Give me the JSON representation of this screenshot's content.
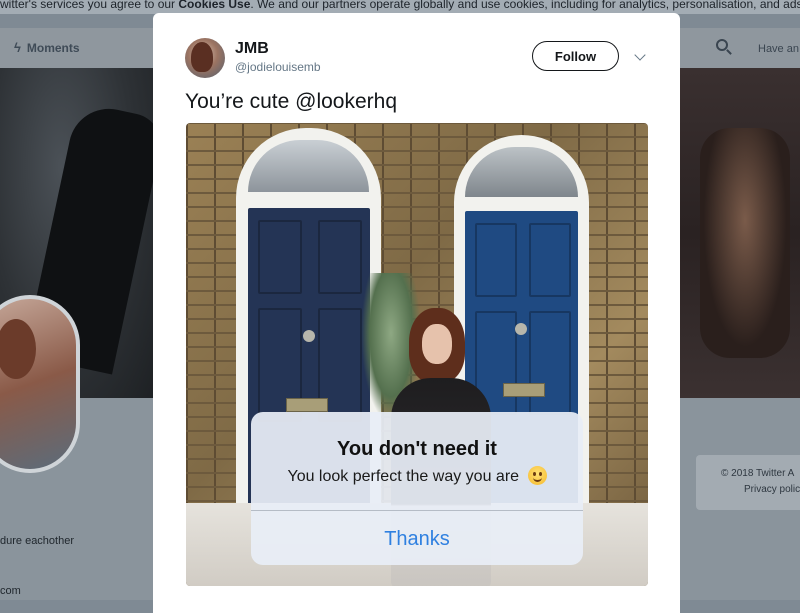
{
  "background_page": {
    "cookie_bar": {
      "prefix": "witter's services you agree to our ",
      "link": "Cookies Use",
      "suffix": ". We and our partners operate globally and use cookies, including for analytics, personalisation, and ads."
    },
    "nav": {
      "moments_label": "Moments",
      "have_account_label": "Have an"
    },
    "profile": {
      "bio_line": "dure eachother",
      "bio_line2": "com"
    },
    "footer": {
      "copyright": "© 2018 Twitter  A",
      "privacy": "Privacy polic"
    }
  },
  "tweet": {
    "author_name": "JMB",
    "author_handle": "@jodielouisemb",
    "follow_label": "Follow",
    "text": "You’re cute @lookerhq"
  },
  "alert": {
    "title": "You don't need it",
    "message": "You look perfect the way you are",
    "action_label": "Thanks"
  },
  "colors": {
    "accent": "#2f80e0",
    "navy_door": "#243455",
    "blue_door": "#1f4a82"
  }
}
